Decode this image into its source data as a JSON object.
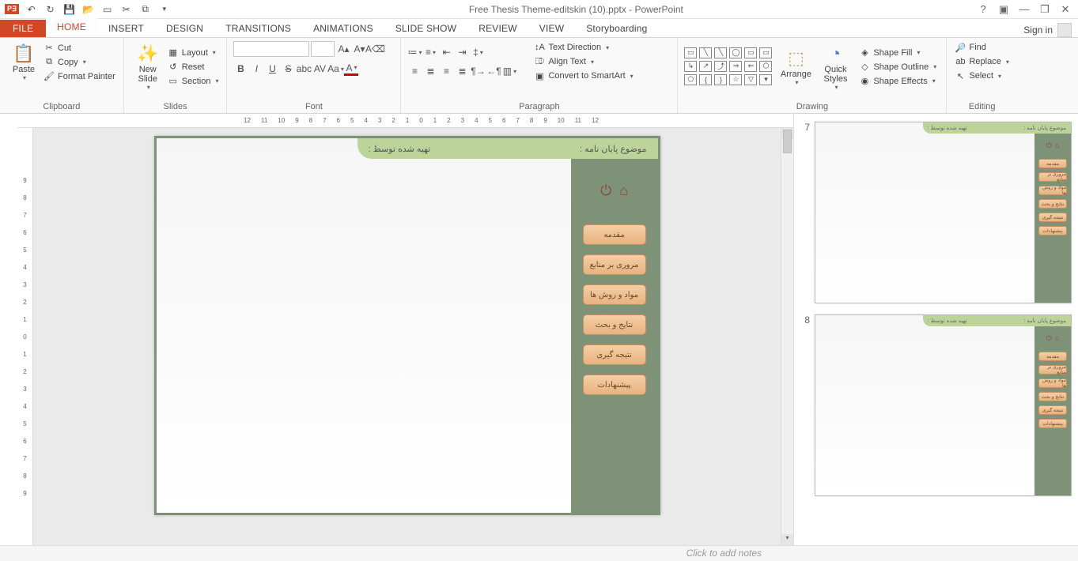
{
  "titlebar": {
    "app": "P",
    "title": "Free Thesis Theme-editskin (10).pptx - PowerPoint"
  },
  "signin": "Sign in",
  "tabs": {
    "file": "FILE",
    "home": "HOME",
    "insert": "INSERT",
    "design": "DESIGN",
    "transitions": "TRANSITIONS",
    "animations": "ANIMATIONS",
    "slideshow": "SLIDE SHOW",
    "review": "REVIEW",
    "view": "VIEW",
    "storyboarding": "Storyboarding"
  },
  "ribbon": {
    "clipboard": {
      "label": "Clipboard",
      "paste": "Paste",
      "cut": "Cut",
      "copy": "Copy",
      "format_painter": "Format Painter"
    },
    "slides": {
      "label": "Slides",
      "new_slide": "New\nSlide",
      "layout": "Layout",
      "reset": "Reset",
      "section": "Section"
    },
    "font": {
      "label": "Font"
    },
    "paragraph": {
      "label": "Paragraph",
      "text_direction": "Text Direction",
      "align_text": "Align Text",
      "convert_smartart": "Convert to SmartArt"
    },
    "drawing": {
      "label": "Drawing",
      "arrange": "Arrange",
      "quick_styles": "Quick\nStyles",
      "shape_fill": "Shape Fill",
      "shape_outline": "Shape Outline",
      "shape_effects": "Shape Effects"
    },
    "editing": {
      "label": "Editing",
      "find": "Find",
      "replace": "Replace",
      "select": "Select"
    }
  },
  "ruler_marks": [
    "12",
    "11",
    "10",
    "9",
    "8",
    "7",
    "6",
    "5",
    "4",
    "3",
    "2",
    "1",
    "0",
    "1",
    "2",
    "3",
    "4",
    "5",
    "6",
    "7",
    "8",
    "9",
    "10",
    "11",
    "12"
  ],
  "ruler_v": [
    "9",
    "8",
    "7",
    "6",
    "5",
    "4",
    "3",
    "2",
    "1",
    "0",
    "1",
    "2",
    "3",
    "4",
    "5",
    "6",
    "7",
    "8",
    "9"
  ],
  "slide": {
    "top_right": "موضوع پایان نامه :",
    "top_left": "تهیه شده توسط :",
    "nav": [
      "مقدمه",
      "مروری بر منابع",
      "مواد و روش ها",
      "نتایج و بحث",
      "نتیجه گیری",
      "پیشنهادات"
    ]
  },
  "thumbs": [
    {
      "num": "7"
    },
    {
      "num": "8"
    }
  ],
  "notes_placeholder": "Click to add notes"
}
